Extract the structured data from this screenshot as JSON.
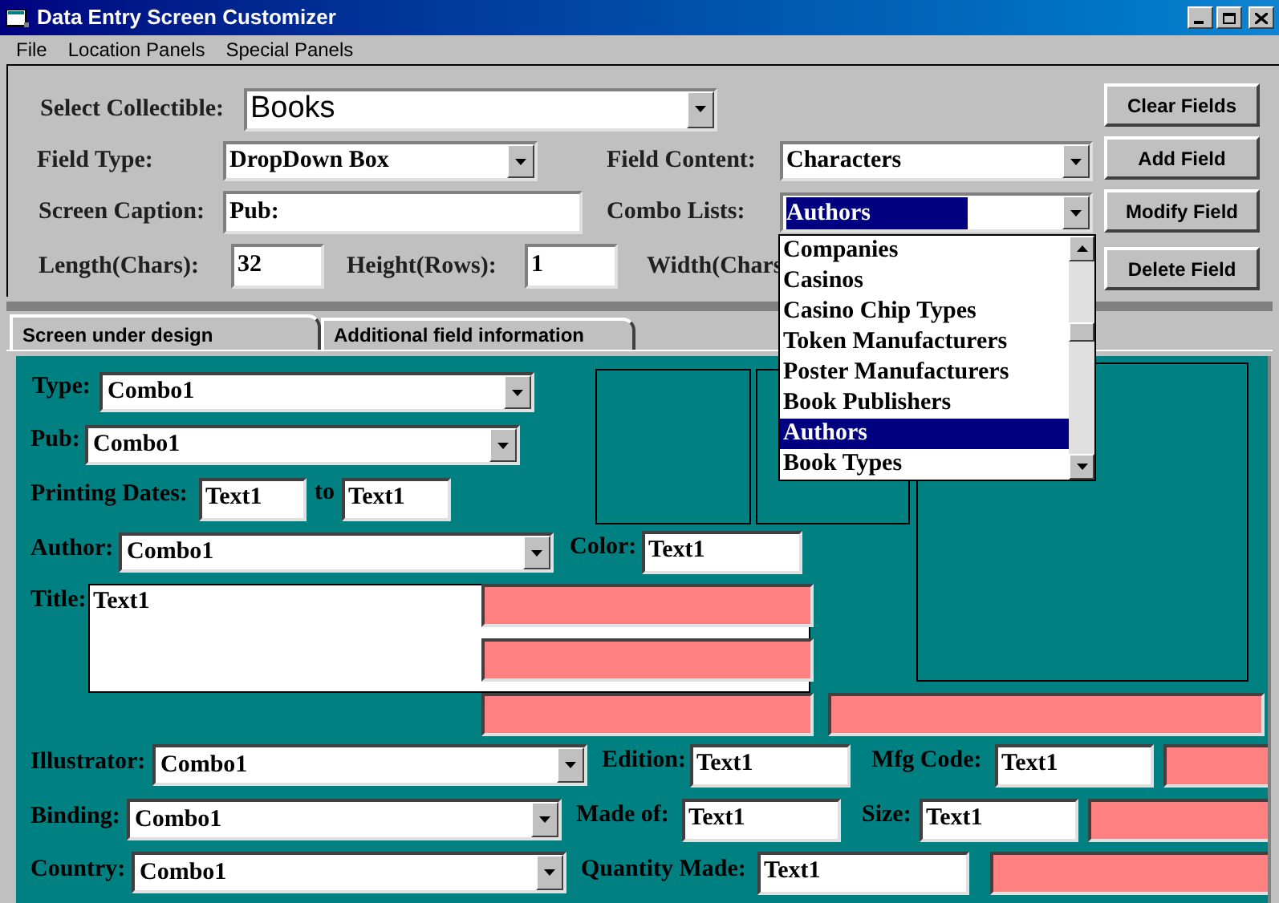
{
  "window": {
    "title": "Data Entry Screen Customizer"
  },
  "menu": [
    "File",
    "Location Panels",
    "Special Panels"
  ],
  "select_collectible": {
    "label": "Select Collectible:",
    "value": "Books"
  },
  "field_type": {
    "label": "Field Type:",
    "value": "DropDown Box"
  },
  "field_content": {
    "label": "Field Content:",
    "value": "Characters"
  },
  "screen_caption": {
    "label": "Screen Caption:",
    "value": "Pub:"
  },
  "combo_lists": {
    "label": "Combo Lists:",
    "value": "Authors",
    "highlighted": true,
    "expanded": true,
    "options": [
      {
        "label": "Companies",
        "selected": false
      },
      {
        "label": "Casinos",
        "selected": false
      },
      {
        "label": "Casino Chip Types",
        "selected": false
      },
      {
        "label": "Token Manufacturers",
        "selected": false
      },
      {
        "label": "Poster Manufacturers",
        "selected": false
      },
      {
        "label": "Book Publishers",
        "selected": false
      },
      {
        "label": "Authors",
        "selected": true
      },
      {
        "label": "Book Types",
        "selected": false
      }
    ]
  },
  "length": {
    "label": "Length(Chars):",
    "value": "32"
  },
  "height": {
    "label": "Height(Rows):",
    "value": "1"
  },
  "width": {
    "label": "Width(Chars"
  },
  "buttons": [
    "Clear Fields",
    "Add Field",
    "Modify Field",
    "Delete Field"
  ],
  "tabs": [
    {
      "label": "Screen under design",
      "selected": true
    },
    {
      "label": "Additional field information",
      "selected": false
    }
  ],
  "design_controls": [
    {
      "kind": "label",
      "text": "Type:"
    },
    {
      "kind": "combo",
      "value": "Combo1"
    },
    {
      "kind": "label",
      "text": "Pub:"
    },
    {
      "kind": "combo",
      "value": "Combo1"
    },
    {
      "kind": "label",
      "text": "Printing Dates:"
    },
    {
      "kind": "text",
      "value": "Text1"
    },
    {
      "kind": "label",
      "text": "to"
    },
    {
      "kind": "text",
      "value": "Text1"
    },
    {
      "kind": "label",
      "text": "Author:"
    },
    {
      "kind": "combo",
      "value": "Combo1"
    },
    {
      "kind": "label",
      "text": "Color:"
    },
    {
      "kind": "text",
      "value": "Text1"
    },
    {
      "kind": "label",
      "text": "Title:"
    },
    {
      "kind": "textarea",
      "value": "Text1"
    },
    {
      "kind": "blank"
    },
    {
      "kind": "blank"
    },
    {
      "kind": "blank"
    },
    {
      "kind": "blank"
    },
    {
      "kind": "frame"
    },
    {
      "kind": "frame"
    },
    {
      "kind": "frame"
    },
    {
      "kind": "label",
      "text": "Illustrator:"
    },
    {
      "kind": "combo",
      "value": "Combo1"
    },
    {
      "kind": "label",
      "text": "Edition:"
    },
    {
      "kind": "text",
      "value": "Text1"
    },
    {
      "kind": "label",
      "text": "Mfg Code:"
    },
    {
      "kind": "text",
      "value": "Text1"
    },
    {
      "kind": "blank"
    },
    {
      "kind": "label",
      "text": "Binding:"
    },
    {
      "kind": "combo",
      "value": "Combo1"
    },
    {
      "kind": "label",
      "text": "Made of:"
    },
    {
      "kind": "text",
      "value": "Text1"
    },
    {
      "kind": "label",
      "text": "Size:"
    },
    {
      "kind": "text",
      "value": "Text1"
    },
    {
      "kind": "blank"
    },
    {
      "kind": "label",
      "text": "Country:"
    },
    {
      "kind": "combo",
      "value": "Combo1"
    },
    {
      "kind": "label",
      "text": "Quantity Made:"
    },
    {
      "kind": "text",
      "value": "Text1"
    },
    {
      "kind": "blank"
    }
  ]
}
